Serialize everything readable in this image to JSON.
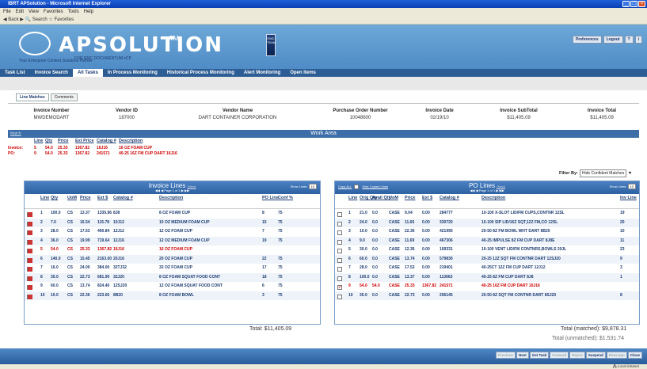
{
  "window": {
    "title": "IBRT APSolution - Microsoft Internet Explorer"
  },
  "menu": [
    "File",
    "Edit",
    "View",
    "Favorites",
    "Tools",
    "Help"
  ],
  "toolbar": {
    "back": "Back",
    "search": "Search",
    "favorites": "Favorites"
  },
  "app": {
    "logo": "APSOLUTION",
    "tm": "TM",
    "sub": "FOR EMC DOCUMENTUM xCP",
    "tagline": "Your Enterprise Content Solutions Partner",
    "emc_team": "EMC TEAM"
  },
  "header_buttons": [
    "Preferences",
    "Logout",
    "?",
    "i"
  ],
  "nav": [
    {
      "label": "Task List"
    },
    {
      "label": "Invoice Search"
    },
    {
      "label": "All Tasks",
      "active": true
    },
    {
      "label": "In Process Monitoring"
    },
    {
      "label": "Historical Process Monitoring"
    },
    {
      "label": "Alert Monitoring"
    },
    {
      "label": "Open Items"
    }
  ],
  "subtabs": [
    {
      "label": "Line Matches",
      "active": true
    },
    {
      "label": "Comments"
    }
  ],
  "invoice_header": {
    "columns": [
      {
        "label": "Invoice Number",
        "value": "MWDEMODART"
      },
      {
        "label": "Vendor ID",
        "value": "187000"
      },
      {
        "label": "Vendor Name",
        "value": "DART CONTAINER CORPORATION"
      },
      {
        "label": "Purchase Order Number",
        "value": "10048600"
      },
      {
        "label": "Invoice Date",
        "value": "02/19/10"
      },
      {
        "label": "Invoice SubTotal",
        "value": "$11,405.09"
      },
      {
        "label": "Invoice Total",
        "value": "$11,405.09"
      }
    ]
  },
  "work_area": {
    "title": "Work Area",
    "match_link": "Match",
    "headers": [
      "Line",
      "Qty",
      "Price",
      "Ext Price",
      "Catalog #",
      "Description"
    ],
    "rows": [
      {
        "label": "Invoice:",
        "line": "5",
        "qty": "54.0",
        "price": "25.33",
        "ext": "1367.82",
        "cat": "16J16",
        "desc": "16 OZ FOAM CUP"
      },
      {
        "label": "PO:",
        "line": "9",
        "qty": "54.0",
        "price": "25.33",
        "ext": "1367.82",
        "cat": "241571",
        "desc": "40-25 16Z FM CUP DART 16J16"
      }
    ]
  },
  "filter": {
    "label": "Filter By:",
    "value": "Hide Confident Matches"
  },
  "invoice_lines": {
    "title": "Invoice Lines",
    "title_link": "(New)",
    "page_text": "Page 1 of 1",
    "show_label": "Show Lines:",
    "show_value": "10",
    "headers": {
      "line": "Line",
      "qty": "Qty",
      "uom": "UoM",
      "price": "Price",
      "ext": "Ext $",
      "cat": "Catalog #",
      "desc": "Description",
      "po": "PO Line",
      "conf": "Conf %"
    },
    "rows": [
      {
        "line": "1",
        "qty": "100.0",
        "uom": "CS",
        "price": "13.37",
        "ext": "1335.96",
        "cat": "8J8",
        "desc": "8 OZ FOAM CUP",
        "po": "8",
        "conf": "75"
      },
      {
        "line": "2",
        "qty": "7.0",
        "uom": "CS",
        "price": "16.54",
        "ext": "115.78",
        "cat": "10J12",
        "desc": "10 OZ MEDIUM FOAM CUP",
        "po": "15",
        "conf": "75"
      },
      {
        "line": "3",
        "qty": "28.0",
        "uom": "CS",
        "price": "17.53",
        "ext": "490.84",
        "cat": "12J12",
        "desc": "12 OZ FOAM CUP",
        "po": "7",
        "conf": "75"
      },
      {
        "line": "4",
        "qty": "36.0",
        "uom": "CS",
        "price": "19.99",
        "ext": "719.64",
        "cat": "12J16",
        "desc": "12 OZ MEDIUM FOAM CUP",
        "po": "19",
        "conf": "75"
      },
      {
        "line": "5",
        "qty": "54.0",
        "uom": "CS",
        "price": "25.33",
        "ext": "1367.82",
        "cat": "16J16",
        "desc": "16 OZ FOAM CUP",
        "po": "",
        "conf": "",
        "checked": true,
        "red": true
      },
      {
        "line": "6",
        "qty": "140.0",
        "uom": "CS",
        "price": "15.45",
        "ext": "2163.00",
        "cat": "20J16",
        "desc": "20 OZ FOAM CUP",
        "po": "22",
        "conf": "75"
      },
      {
        "line": "7",
        "qty": "16.0",
        "uom": "CS",
        "price": "24.00",
        "ext": "384.00",
        "cat": "32TJ32",
        "desc": "32 OZ FOAM CUP",
        "po": "17",
        "conf": "75"
      },
      {
        "line": "8",
        "qty": "30.0",
        "uom": "CS",
        "price": "22.73",
        "ext": "681.90",
        "cat": "32J20",
        "desc": "8 OZ FOAM SQUAT FOOD CONT",
        "po": "18",
        "conf": "75"
      },
      {
        "line": "9",
        "qty": "60.0",
        "uom": "CS",
        "price": "13.74",
        "ext": "824.40",
        "cat": "12SJ20",
        "desc": "12 OZ FOAM SQUAT FOOD CONT",
        "po": "6",
        "conf": "75"
      },
      {
        "line": "10",
        "qty": "10.0",
        "uom": "CS",
        "price": "22.36",
        "ext": "223.60",
        "cat": "8B20",
        "desc": "8 OZ FOAM BOWL",
        "po": "3",
        "conf": "75"
      }
    ],
    "total": "Total: $11,405.09"
  },
  "po_lines": {
    "title": "PO Lines",
    "title_link": "(New)",
    "page_text": "Page 1 of 1",
    "show_label": "Show Lines:",
    "show_value": "10",
    "copy_all": "Copy ALL",
    "hide_copied": "Hide Copied Lines",
    "headers": {
      "line": "Line",
      "orig": "Orig Qty",
      "avail": "Avail Qty",
      "uom": "UoM",
      "price": "Price",
      "ext": "Ext $",
      "cat": "Catalog #",
      "desc": "Description",
      "inv": "Inv Line"
    },
    "rows": [
      {
        "line": "1",
        "orig": "21.0",
        "avail": "0.0",
        "uom": "CASE",
        "price": "9.04",
        "ext": "0.00",
        "cat": "284777",
        "desc": "10-100 X-SLOT LID/FM CUPS,CONTNR 12SL",
        "inv": "19"
      },
      {
        "line": "2",
        "orig": "24.0",
        "avail": "0.0",
        "uom": "CASE",
        "price": "11.66",
        "ext": "0.00",
        "cat": "330720",
        "desc": "10-100 SIP LID/16Z SQT,12Z FM,CO 12SL",
        "inv": "20"
      },
      {
        "line": "3",
        "orig": "10.0",
        "avail": "0.0",
        "uom": "CASE",
        "price": "22.36",
        "ext": "0.00",
        "cat": "421995",
        "desc": "20-50 8Z FM BOWL WHT DART 8B20",
        "inv": "10"
      },
      {
        "line": "4",
        "orig": "9.0",
        "avail": "0.0",
        "uom": "CASE",
        "price": "11.69",
        "ext": "0.00",
        "cat": "467306",
        "desc": "40-25 IMPULSE 8Z FM CUP DART 8J8E",
        "inv": "11"
      },
      {
        "line": "5",
        "orig": "30.0",
        "avail": "0.0",
        "uom": "CASE",
        "price": "12.36",
        "ext": "0.00",
        "cat": "169331",
        "desc": "10-100 VENT LID/FM CONTNRS,BOWLS 20JL",
        "inv": "23"
      },
      {
        "line": "6",
        "orig": "60.0",
        "avail": "0.0",
        "uom": "CASE",
        "price": "13.74",
        "ext": "0.00",
        "cat": "579830",
        "desc": "20-25 12Z SQT FM CONTNR DART 12SJ20",
        "inv": "9"
      },
      {
        "line": "7",
        "orig": "28.0",
        "avail": "0.0",
        "uom": "CASE",
        "price": "17.53",
        "ext": "0.00",
        "cat": "219401",
        "desc": "40-25CT 12Z FM CUP DART 12J12",
        "inv": "3"
      },
      {
        "line": "8",
        "orig": "100.0",
        "avail": "0.0",
        "uom": "CASE",
        "price": "13.37",
        "ext": "0.00",
        "cat": "113663",
        "desc": "40-25 8Z FM CUP DART 8J8",
        "inv": "1"
      },
      {
        "line": "9",
        "orig": "54.0",
        "avail": "54.0",
        "uom": "CASE",
        "price": "25.33",
        "ext": "1367.82",
        "cat": "241571",
        "desc": "40-25 16Z FM CUP DART 16J16",
        "inv": "",
        "checked": true,
        "red": true
      },
      {
        "line": "10",
        "orig": "30.0",
        "avail": "0.0",
        "uom": "CASE",
        "price": "22.73",
        "ext": "0.00",
        "cat": "256145",
        "desc": "20-50 8Z SQT FM CONTNR DART 8SJ20",
        "inv": "8"
      }
    ],
    "total_matched": "Total (matched): $9,878.31",
    "total_unmatched": "Total (unmatched): $1,531.74"
  },
  "footer_buttons": [
    {
      "label": "Previous",
      "dim": true
    },
    {
      "label": "Next"
    },
    {
      "label": "Get Task"
    },
    {
      "label": "Forward",
      "dim": true
    },
    {
      "label": "Reject",
      "dim": true
    },
    {
      "label": "Suspend"
    },
    {
      "label": "Reassign",
      "dim": true
    },
    {
      "label": "Close"
    }
  ],
  "status": {
    "zone": "Local intranet"
  }
}
